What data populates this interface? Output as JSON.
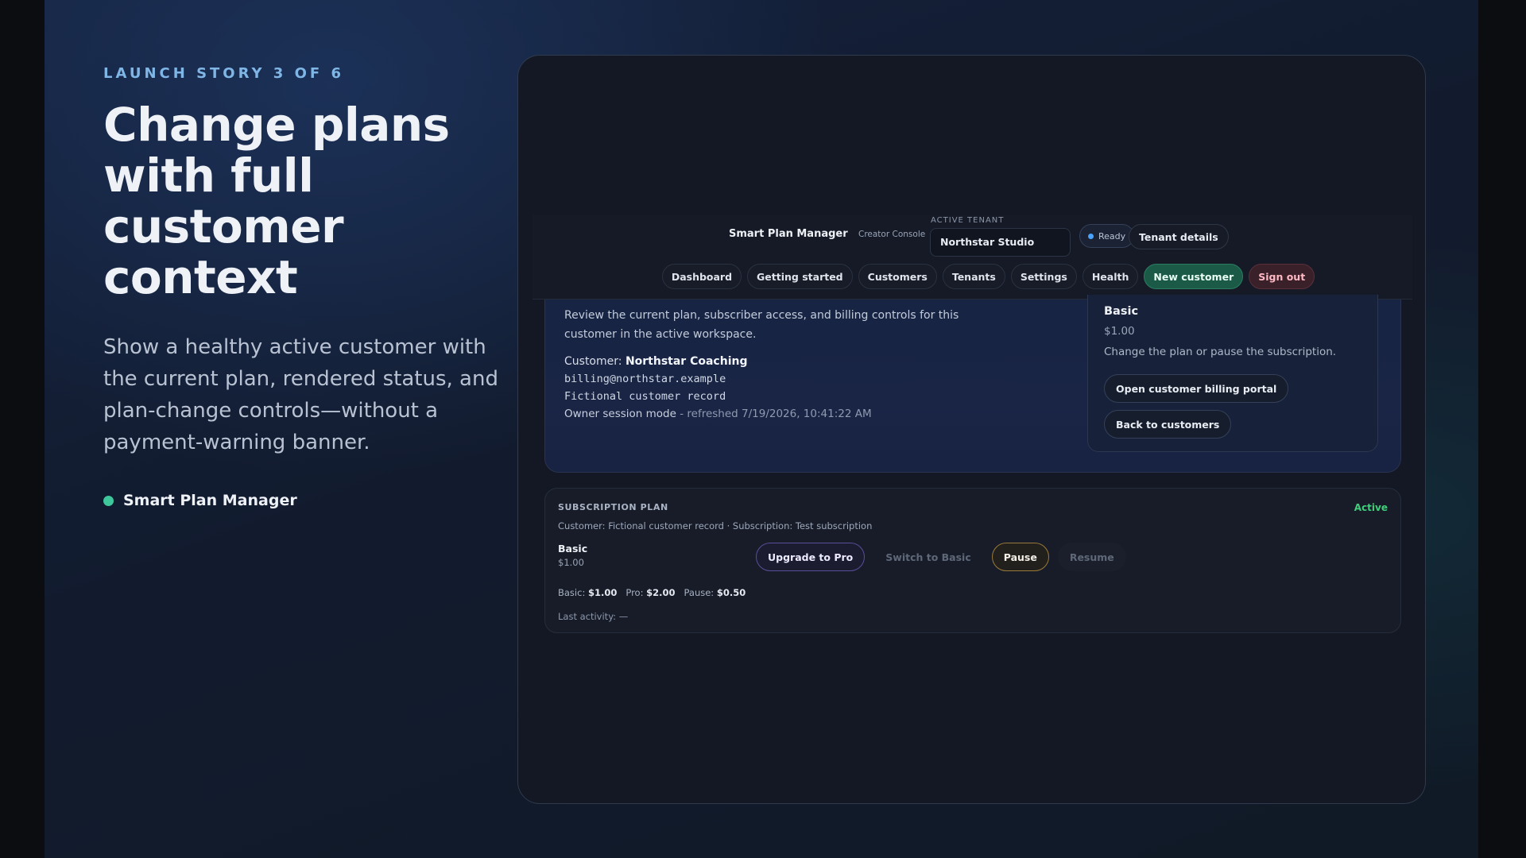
{
  "pitch": {
    "eyebrow": "LAUNCH STORY 3 OF 6",
    "headline": "Change plans with full customer context",
    "subcopy": "Show a healthy active customer with the current plan, rendered status, and plan-change controls—without a payment-warning banner.",
    "brand": "Smart Plan Manager",
    "brand_dot_color": "#3ec79a"
  },
  "app": {
    "title": "Smart Plan Manager",
    "subtitle": "Creator Console",
    "tenant_label": "ACTIVE TENANT",
    "tenant_value": "Northstar Studio",
    "status": "Ready",
    "tenant_details": "Tenant details",
    "nav": {
      "dashboard": "Dashboard",
      "getting_started": "Getting started",
      "customers": "Customers",
      "tenants": "Tenants",
      "settings": "Settings",
      "health": "Health",
      "new_customer": "New customer",
      "sign_out": "Sign out"
    }
  },
  "customer": {
    "description": "Review the current plan, subscriber access, and billing controls for this customer in the active workspace.",
    "label": "Customer:",
    "name": "Northstar Coaching",
    "email": "billing@northstar.example",
    "record": "Fictional customer record",
    "mode": "Owner session mode",
    "refreshed": "- refreshed 7/19/2026, 10:41:22 AM"
  },
  "plan_box": {
    "name": "Basic",
    "price": "$1.00",
    "description": "Change the plan or pause the subscription.",
    "portal_button": "Open customer billing portal",
    "back_button": "Back to customers"
  },
  "subscription": {
    "title": "SUBSCRIPTION PLAN",
    "status": "Active",
    "status_color": "#3fcf7a",
    "meta": "Customer: Fictional customer record · Subscription: Test subscription",
    "plan": "Basic",
    "price": "$1.00",
    "actions": {
      "upgrade": "Upgrade to Pro",
      "switch": "Switch to Basic",
      "pause": "Pause",
      "resume": "Resume"
    },
    "prices": {
      "basic_label": "Basic:",
      "basic_value": "$1.00",
      "pro_label": "Pro:",
      "pro_value": "$2.00",
      "pause_label": "Pause:",
      "pause_value": "$0.50"
    },
    "last_activity": "Last activity: —"
  }
}
